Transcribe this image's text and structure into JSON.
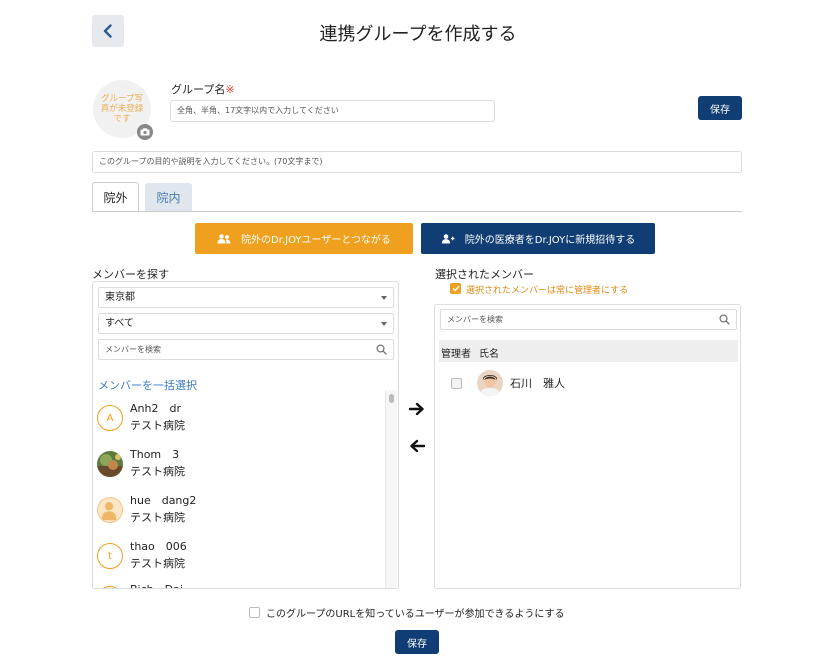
{
  "header": {
    "title": "連携グループを作成する",
    "back_icon": "chevron-left-icon"
  },
  "group_photo": {
    "text": "グループ写真が未登録です",
    "camera_icon": "camera-icon"
  },
  "form": {
    "name_label": "グループ名",
    "required_mark": "※",
    "name_placeholder": "全角、半角、17文字以内で入力してください",
    "save_label": "保存",
    "description_placeholder": "このグループの目的や説明を入力してください。(70文字まで)"
  },
  "tabs": [
    {
      "label": "院外",
      "active": true
    },
    {
      "label": "院内",
      "active": false
    }
  ],
  "actions": {
    "connect_label": "院外のDr.JOYユーザーとつながる",
    "connect_icon": "users-icon",
    "invite_label": "院外の医療者をDr.JOYに新規招待する",
    "invite_icon": "user-plus-icon"
  },
  "colors": {
    "primary": "#0f3d74",
    "accent": "#f0a01f",
    "link": "#3b7cc4"
  },
  "search_panel": {
    "title": "メンバーを探す",
    "prefecture": "東京都",
    "category": "すべて",
    "search_placeholder": "メンバーを検索",
    "select_all": "メンバーを一括選択",
    "members": [
      {
        "name": "Anh2　dr",
        "hospital": "テスト病院",
        "avatar": "A"
      },
      {
        "name": "Thom　3",
        "hospital": "テスト病院",
        "avatar": "photo"
      },
      {
        "name": "hue　dang2",
        "hospital": "テスト病院",
        "avatar": "silhouette"
      },
      {
        "name": "thao　006",
        "hospital": "テスト病院",
        "avatar": "t"
      },
      {
        "name": "Bich　Dai",
        "hospital": "",
        "avatar": "B"
      }
    ]
  },
  "selected_panel": {
    "title": "選択されたメンバー",
    "always_admin_label": "選択されたメンバーは常に管理者にする",
    "always_admin_checked": true,
    "search_placeholder": "メンバーを検索",
    "col_admin": "管理者",
    "col_name": "氏名",
    "rows": [
      {
        "name": "石川　雅人",
        "admin": false
      }
    ]
  },
  "footer": {
    "url_join_label": "このグループのURLを知っているユーザーが参加できるようにする",
    "url_join_checked": false,
    "save_label": "保存"
  }
}
